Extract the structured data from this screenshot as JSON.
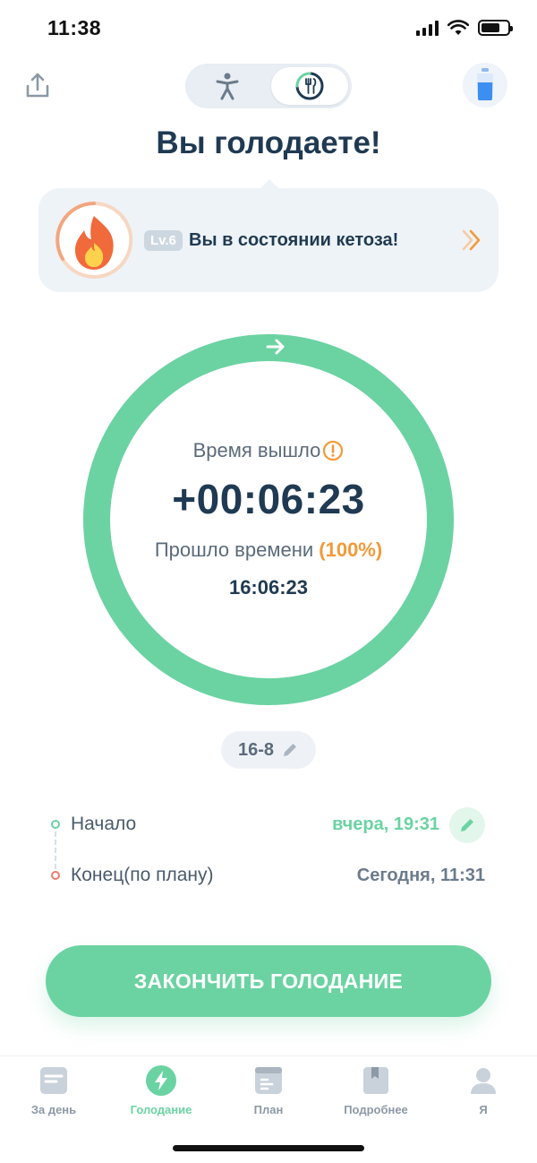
{
  "status_bar": {
    "time": "11:38"
  },
  "header": {
    "share_icon": "share-icon",
    "toggle": {
      "left_icon": "person-icon",
      "right_icon": "fasting-clock-icon",
      "active": "right"
    },
    "water_icon": "water-glass-icon"
  },
  "title": "Вы голодаете!",
  "ketosis_card": {
    "level": "Lv.6",
    "text": "Вы в состоянии кетоза!",
    "icon": "flame-icon"
  },
  "timer": {
    "label": "Время вышло",
    "value": "+00:06:23",
    "elapsed_label": "Прошло времени",
    "elapsed_percent": "(100%)",
    "elapsed_time": "16:06:23",
    "progress": 1.0
  },
  "plan": {
    "label": "16-8"
  },
  "schedule": {
    "start_label": "Начало",
    "start_value": "вчера, 19:31",
    "end_label": "Конец(по плану)",
    "end_value": "Сегодня, 11:31"
  },
  "main_button": {
    "label": "ЗАКОНЧИТЬ ГОЛОДАНИЕ"
  },
  "tabs": [
    {
      "label": "За день",
      "icon": "document-icon",
      "active": false
    },
    {
      "label": "Голодание",
      "icon": "lightning-icon",
      "active": true
    },
    {
      "label": "План",
      "icon": "plan-list-icon",
      "active": false
    },
    {
      "label": "Подробнее",
      "icon": "bookmark-book-icon",
      "active": false
    },
    {
      "label": "Я",
      "icon": "profile-icon",
      "active": false
    }
  ],
  "colors": {
    "accent_green": "#6bd3a2",
    "warning_orange": "#f29a3a",
    "title_navy": "#1f3a52",
    "end_dot_red": "#ef7b6f"
  }
}
